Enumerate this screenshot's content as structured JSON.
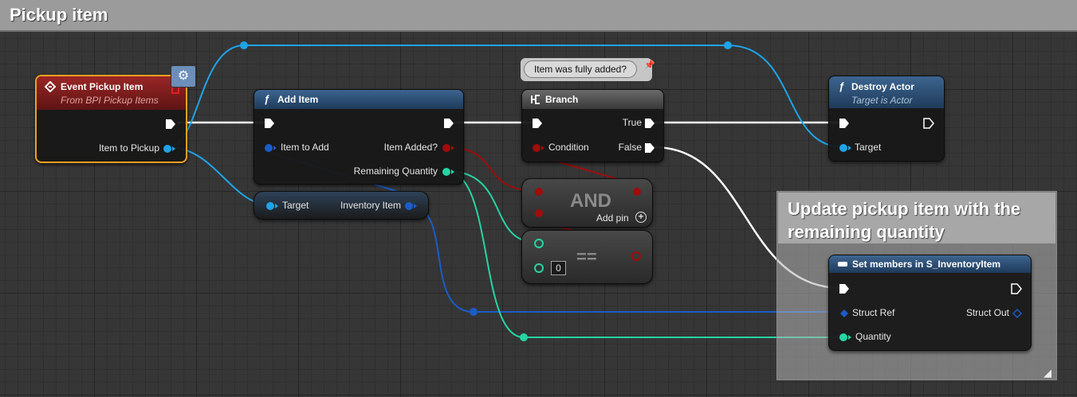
{
  "comments": {
    "main_title": "Pickup item",
    "update_title": "Update pickup item with the remaining quantity"
  },
  "nodes": {
    "event": {
      "title": "Event Pickup Item",
      "subtitle": "From BPI Pickup Items",
      "output_label": "Item to Pickup"
    },
    "add_item": {
      "title": "Add Item",
      "input_label": "Item to Add",
      "output_added": "Item Added?",
      "output_remaining": "Remaining Quantity"
    },
    "target_getter": {
      "input_label": "Target",
      "output_label": "Inventory Item"
    },
    "branch": {
      "title": "Branch",
      "comment": "Item was fully added?",
      "condition_label": "Condition",
      "true_label": "True",
      "false_label": "False"
    },
    "and_node": {
      "label": "AND",
      "add_pin_label": "Add pin"
    },
    "equals_node": {
      "label": "==",
      "default_value": "0"
    },
    "destroy": {
      "title": "Destroy Actor",
      "subtitle": "Target is Actor",
      "target_label": "Target"
    },
    "set_members": {
      "title": "Set members in S_InventoryItem",
      "struct_ref_label": "Struct Ref",
      "struct_out_label": "Struct Out",
      "quantity_label": "Quantity"
    }
  },
  "colors": {
    "exec": "#ffffff",
    "object": "#1fa3e8",
    "bool": "#a00c0c",
    "int": "#26d4a4",
    "struct": "#1a5cc8",
    "event_header": "#8b1d1d",
    "function_header": "#2a4868",
    "selected_border": "#f0a020"
  }
}
